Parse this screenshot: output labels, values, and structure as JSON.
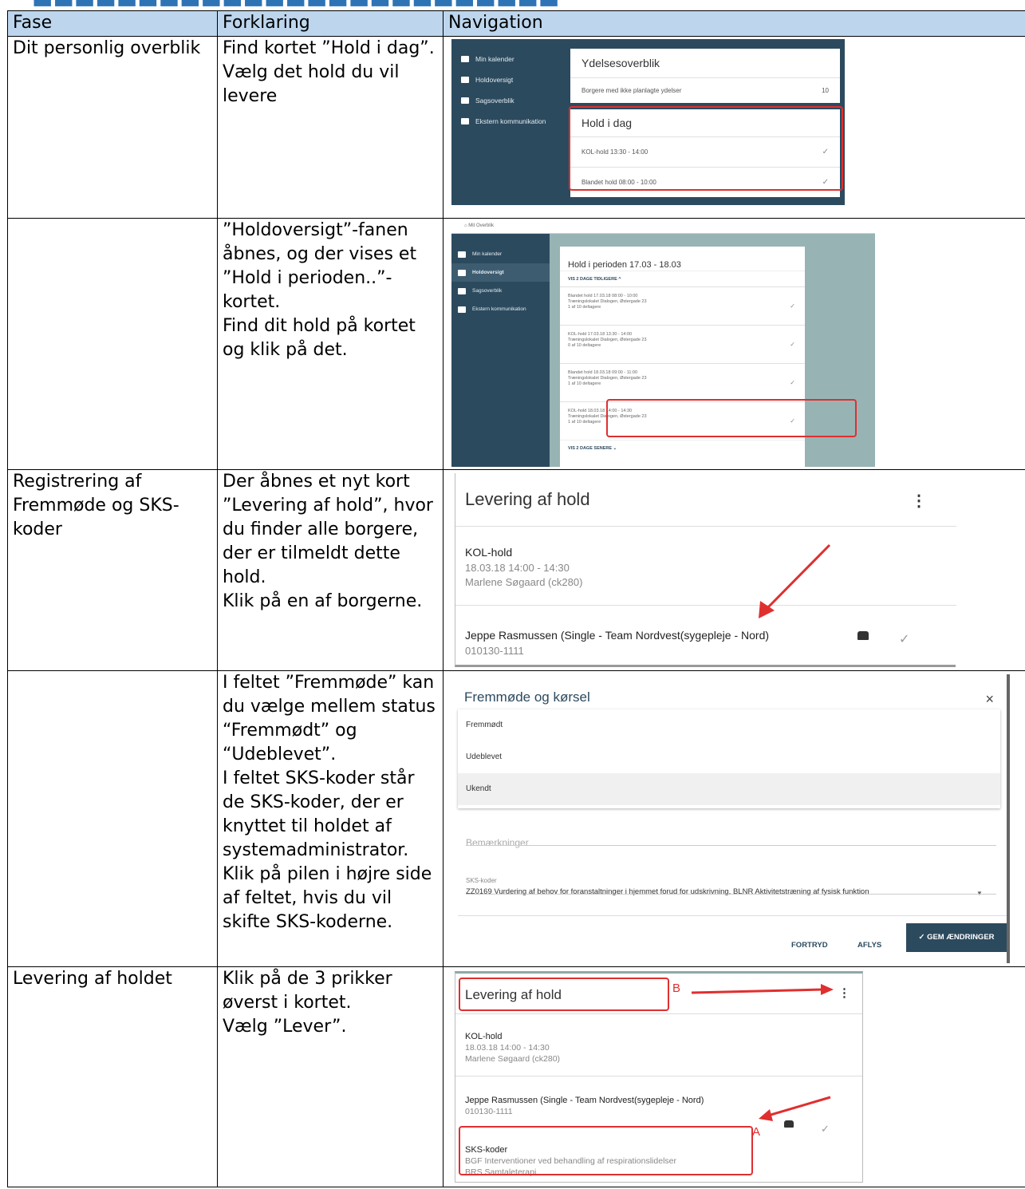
{
  "table": {
    "headers": [
      "Fase",
      "Forklaring",
      "Navigation"
    ],
    "rows": [
      {
        "fase": "Dit personlig overblik",
        "forklaring": "Find kortet ”Hold i dag”.\nVælg det hold du vil levere"
      },
      {
        "fase": "",
        "forklaring": "”Holdoversigt”-fanen åbnes, og der vises et ”Hold i perioden..”-kortet.\nFind dit hold på kortet og klik på det."
      },
      {
        "fase": "Registrering af Fremmøde og SKS-koder",
        "forklaring": "Der åbnes et nyt kort ”Levering af hold”, hvor du finder alle borgere, der er tilmeldt dette hold.\nKlik på en af borgerne."
      },
      {
        "fase": "",
        "forklaring": "I feltet ”Fremmøde” kan du vælge mellem status “Fremmødt” og “Udeblevet”.\nI feltet SKS-koder står de SKS-koder, der  er knyttet til holdet af systemadministrator.\nKlik på pilen i højre side af feltet, hvis du vil skifte SKS-koderne."
      },
      {
        "fase": "Levering af holdet",
        "forklaring": "Klik på de 3 prikker øverst i kortet.\nVælg ”Lever”."
      }
    ]
  },
  "shot1": {
    "menu": [
      "Min kalender",
      "Holdoversigt",
      "Sagsoverblik",
      "Ekstern kommunikation"
    ],
    "card1_title": "Ydelsesoverblik",
    "card1_row": "Borgere med ikke planlagte ydelser",
    "card1_count": "10",
    "card2_title": "Hold i dag",
    "items": [
      "KOL-hold 13:30 - 14:00",
      "Blandet hold 08:00 - 10:00"
    ]
  },
  "shot2": {
    "topbar": "Mit Overblik",
    "menu": [
      "Min kalender",
      "Holdoversigt",
      "Sagsoverblik",
      "Ekstern kommunikation"
    ],
    "card_title": "Hold i perioden 17.03 - 18.03",
    "vis_before": "VIS 2 DAGE TIDLIGERE ^",
    "vis_after": "VIS 2 DAGE SENERE ⌄",
    "items": [
      {
        "l1": "Blandet hold 17.03.18 08:00 - 10:00",
        "l2": "Træningslokalet Dialogen, Østergade 23",
        "l3": "1 af 10 deltagere"
      },
      {
        "l1": "KOL-hold 17.03.18 13:30 - 14:00",
        "l2": "Træningslokalet Dialogen, Østergade 23",
        "l3": "0 af 10 deltagere"
      },
      {
        "l1": "Blandet hold 18.03.18 09:00 - 11:00",
        "l2": "Træningslokalet Dialogen, Østergade 23",
        "l3": "1 af 10 deltagere"
      },
      {
        "l1": "KOL-hold 18.03.18 14:00 - 14:30",
        "l2": "Træningslokalet Dialogen, Østergade 23",
        "l3": "1 af 10 deltagere"
      }
    ]
  },
  "shot3": {
    "title": "Levering af hold",
    "hold": "KOL-hold",
    "time": "18.03.18 14:00 - 14:30",
    "person": "Marlene Søgaard (ck280)",
    "citizen": "Jeppe Rasmussen (Single - Team Nordvest(sygepleje - Nord)",
    "cpr": "010130-1111"
  },
  "shot4": {
    "title": "Fremmøde og kørsel",
    "options": [
      "Fremmødt",
      "Udeblevet",
      "Ukendt"
    ],
    "bemaerkninger": "Bemærkninger",
    "sks_label": "SKS-koder",
    "sks_value": "ZZ0169 Vurdering af behov for foranstaltninger i hjemmet forud for udskrivning, BLNR Aktivitetstræning af fysisk funktion",
    "btn_cancel": "FORTRYD",
    "btn_aflys": "AFLYS",
    "btn_save": "✓ GEM ÆNDRINGER"
  },
  "shot5": {
    "title": "Levering af hold",
    "hold": "KOL-hold",
    "time": "18.03.18 14:00 - 14:30",
    "person": "Marlene Søgaard (ck280)",
    "citizen": "Jeppe Rasmussen (Single - Team Nordvest(sygepleje - Nord)",
    "cpr": "010130-1111",
    "sks_label": "SKS-koder",
    "sks1": "BGF Interventioner ved behandling af respirationslidelser",
    "sks2": "BRS Samtaleterapi",
    "label_a": "A",
    "label_b": "B"
  },
  "colors": {
    "heading": "#2E74B5",
    "header_bg": "#BDD6EE",
    "highlight": "#E02F2F",
    "app_dark": "#2C4A5E"
  }
}
